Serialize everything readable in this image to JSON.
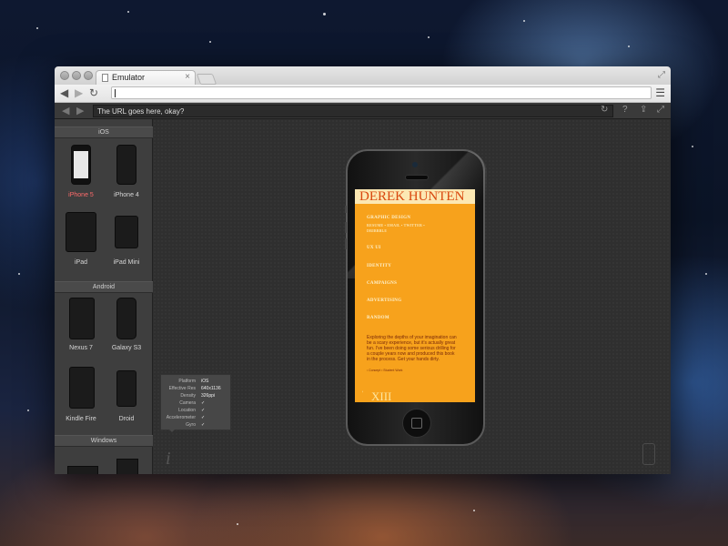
{
  "browser": {
    "tab_title": "Emulator",
    "tab_close": "×",
    "address_value": ""
  },
  "emulator_toolbar": {
    "url_placeholder": "The URL goes here, okay?"
  },
  "sidebar": {
    "sections": [
      {
        "title": "iOS",
        "devices": [
          {
            "label": "iPhone 5",
            "selected": true
          },
          {
            "label": "iPhone 4",
            "selected": false
          },
          {
            "label": "iPad",
            "selected": false
          },
          {
            "label": "iPad Mini",
            "selected": false
          }
        ]
      },
      {
        "title": "Android",
        "devices": [
          {
            "label": "Nexus 7",
            "selected": false
          },
          {
            "label": "Galaxy S3",
            "selected": false
          },
          {
            "label": "Kindle Fire",
            "selected": false
          },
          {
            "label": "Droid",
            "selected": false
          }
        ]
      },
      {
        "title": "Windows",
        "devices": []
      }
    ]
  },
  "device_info": {
    "rows": [
      {
        "key": "Platform",
        "value": "iOS"
      },
      {
        "key": "Effective Res",
        "value": "640x1136"
      },
      {
        "key": "Density",
        "value": "326ppi"
      },
      {
        "key": "Camera",
        "value": "✓"
      },
      {
        "key": "Location",
        "value": "✓"
      },
      {
        "key": "Accelerometer",
        "value": "✓"
      },
      {
        "key": "Gyro",
        "value": "✓"
      }
    ],
    "info_glyph": "i"
  },
  "site": {
    "name": "DEREK HUNTEN",
    "menu": [
      "GRAPHIC DESIGN",
      "UX UI",
      "IDENTITY",
      "CAMPAIGNS",
      "ADVERTISING",
      "RANDOM"
    ],
    "subline_1": "RESUME • EMAIL • TWITTER •",
    "subline_2": "DRIBBBLE",
    "blurb": "Exploring the depths of your imagination can be a scary experience, but it's actually great fun. I've been doing some serious drilling for a couple years now and produced this book in the process. Get your hands dirty.",
    "footnote": "¹ Concept   ² Student Work",
    "roman": "XIII",
    "quote_mark": "‘",
    "colors": {
      "background": "#f7a21c",
      "header": "#fce8b3",
      "name": "#d9480f"
    }
  }
}
